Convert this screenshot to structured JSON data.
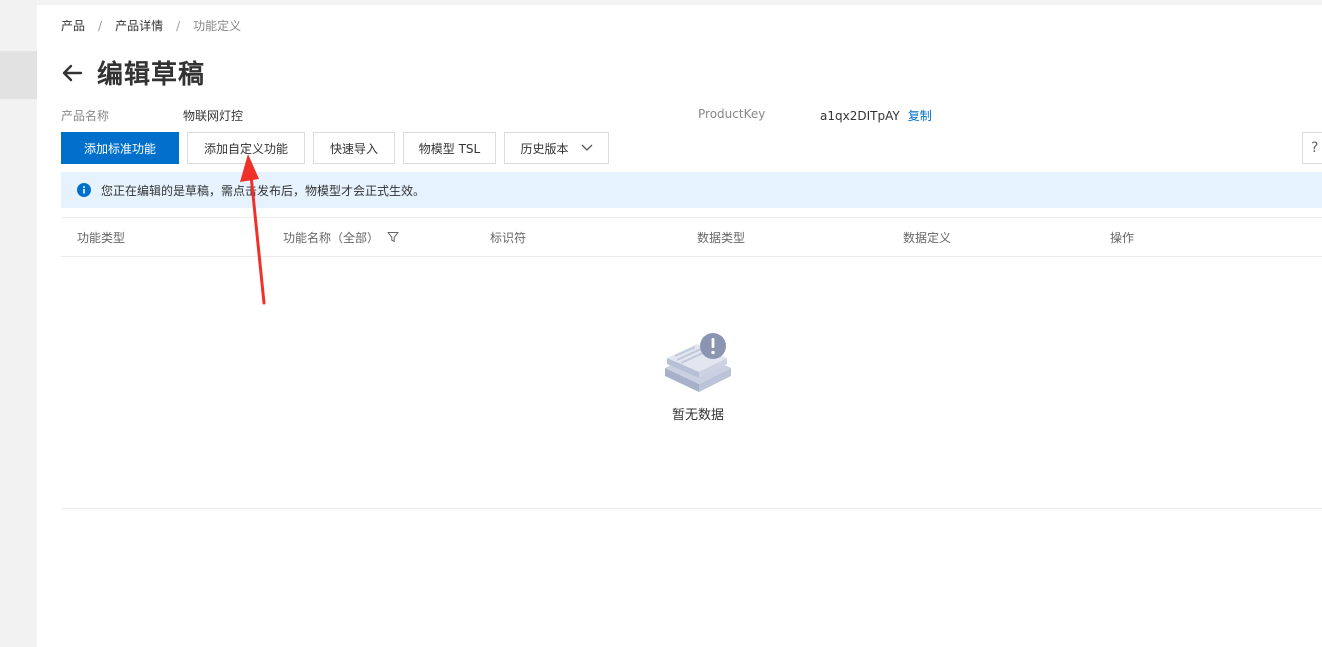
{
  "breadcrumb": [
    "产品",
    "产品详情",
    "功能定义"
  ],
  "page_title": "编辑草稿",
  "product_name": {
    "label": "产品名称",
    "value": "物联网灯控"
  },
  "product_key": {
    "label": "ProductKey",
    "value": "a1qx2DITpAY",
    "copy_label": "复制"
  },
  "toolbar": {
    "add_standard": "添加标准功能",
    "add_custom": "添加自定义功能",
    "quick_import": "快速导入",
    "tsl": "物模型 TSL",
    "history": "历史版本"
  },
  "help_label": "?",
  "notice": "您正在编辑的是草稿，需点击发布后，物模型才会正式生效。",
  "table": {
    "columns": [
      "功能类型",
      "功能名称（全部）",
      "标识符",
      "数据类型",
      "数据定义",
      "操作"
    ]
  },
  "empty_text": "暂无数据",
  "colors": {
    "primary": "#0070cc",
    "notice_bg": "#e6f3fe",
    "annotation_arrow": "#f0312a"
  }
}
